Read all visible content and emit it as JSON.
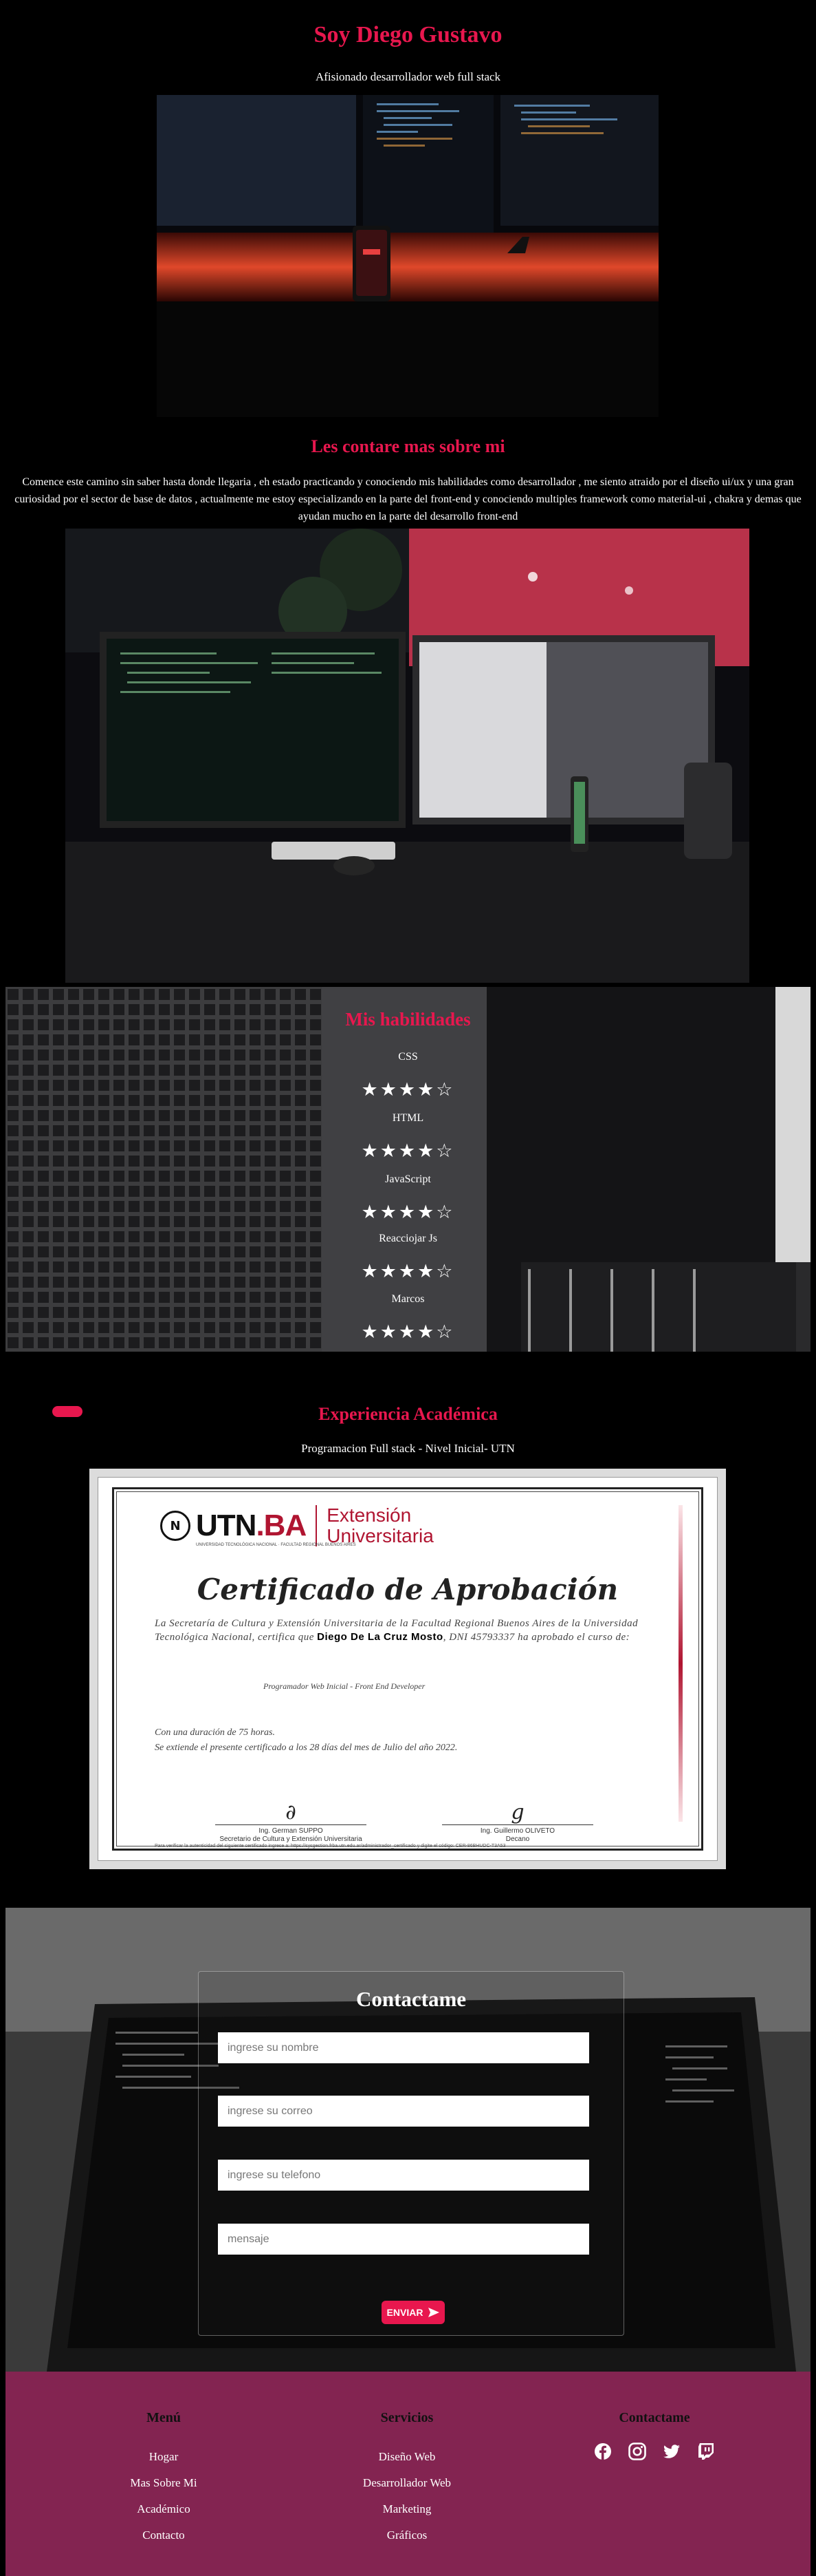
{
  "hero": {
    "title": "Soy Diego Gustavo",
    "subtitle": "Afisionado desarrollador web full stack"
  },
  "about": {
    "title": "Les contare mas sobre mi",
    "text": "Comence este camino sin saber hasta donde llegaria , eh estado practicando y conociendo mis habilidades como desarrollador , me siento atraido por el diseño ui/ux y una gran curiosidad por el sector de base de datos , actualmente me estoy especializando en la parte del front-end y conociendo multiples framework como material-ui , chakra y demas que ayudan mucho en la parte del desarrollo front-end"
  },
  "skills": {
    "title": "Mis habilidades",
    "items": [
      {
        "name": "CSS",
        "rating": 4,
        "max": 5
      },
      {
        "name": "HTML",
        "rating": 4,
        "max": 5
      },
      {
        "name": "JavaScript",
        "rating": 4,
        "max": 5
      },
      {
        "name": "Reacciojar Js",
        "rating": 4,
        "max": 5
      },
      {
        "name": "Marcos",
        "rating": 4,
        "max": 5
      }
    ]
  },
  "academic": {
    "title": "Experiencia Académica",
    "course": "Programacion Full stack - Nivel Inicial- UTN",
    "certificate": {
      "logo_text": "UTN",
      "logo_suffix": ".BA",
      "logo_seal": "N",
      "extension_line1": "Extensión",
      "extension_line2": "Universitaria",
      "logo_small": "UNIVERSIDAD TECNOLÓGICA NACIONAL · FACULTAD REGIONAL BUENOS AIRES",
      "title": "Certificado de Aprobación",
      "body_pre": "La Secretaría de Cultura y Extensión Universitaria de la Facultad Regional Buenos Aires de la Universidad Tecnológica Nacional, certifica que ",
      "name": "Diego De La Cruz Mosto",
      "body_post": ", DNI 45793337 ha aprobado el curso de:",
      "program": "Programador Web Inicial - Front End Developer",
      "duration_line1": "Con una duración de 75 horas.",
      "duration_line2": "Se extiende el presente certificado a los 28 días del mes de Julio del año 2022.",
      "signer1_name": "Ing. German SUPPO",
      "signer1_role": "Secretario de Cultura y Extensión Universitaria",
      "signer2_name": "Ing. Guillermo OLIVETO",
      "signer2_role": "Decano",
      "footer_note": "Para verificar la autenticidad del siguiente certificado ingrese a: https://sysgestion.frba.utn.edu.ar/administrador_certificado y digite el código: CER-86BHUDC-T3A53"
    }
  },
  "contact": {
    "title": "Contactame",
    "name_placeholder": "ingrese su nombre",
    "email_placeholder": "ingrese su correo",
    "phone_placeholder": "ingrese su telefono",
    "message_placeholder": "mensaje",
    "send_label": "ENVIAR"
  },
  "footer": {
    "menu": {
      "title": "Menú",
      "links": [
        "Hogar",
        "Mas Sobre Mi",
        "Académico",
        "Contacto"
      ]
    },
    "services": {
      "title": "Servicios",
      "links": [
        "Diseño Web",
        "Desarrollador Web",
        "Marketing",
        "Gráficos"
      ]
    },
    "contact": {
      "title": "Contactame",
      "icons": [
        "facebook-icon",
        "instagram-icon",
        "twitter-icon",
        "twitch-icon"
      ]
    }
  },
  "colors": {
    "accent": "#e8174e",
    "footer_bg": "#832451",
    "background": "#000000"
  }
}
